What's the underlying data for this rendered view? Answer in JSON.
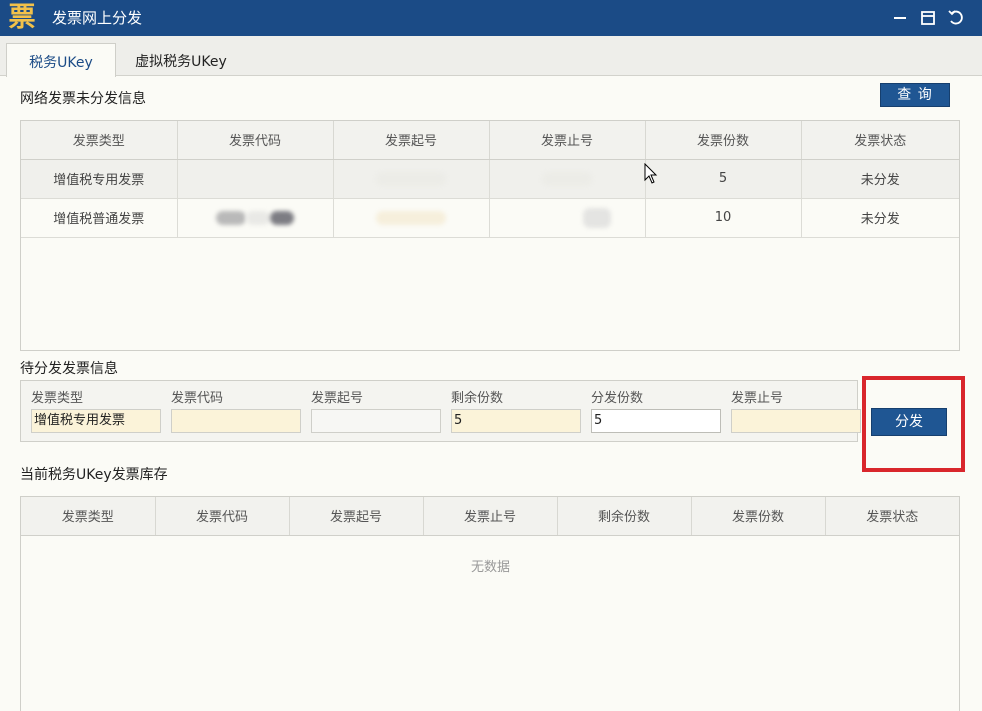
{
  "window": {
    "icon_glyph": "票",
    "title": "发票网上分发",
    "controls": [
      "minimize-icon",
      "maximize-icon",
      "back-icon"
    ]
  },
  "tabs": [
    {
      "label": "税务UKey",
      "active": true
    },
    {
      "label": "虚拟税务UKey",
      "active": false
    }
  ],
  "network_section": {
    "title": "网络发票未分发信息",
    "query_button": "查 询",
    "columns": [
      "发票类型",
      "发票代码",
      "发票起号",
      "发票止号",
      "发票份数",
      "发票状态"
    ],
    "rows": [
      {
        "type": "增值税专用发票",
        "code": "",
        "start": "",
        "end": "",
        "count": "5",
        "status": "未分发"
      },
      {
        "type": "增值税普通发票",
        "code": "",
        "start": "",
        "end": "",
        "count": "10",
        "status": "未分发"
      }
    ]
  },
  "pending_section": {
    "title": "待分发发票信息",
    "labels": {
      "type": "发票类型",
      "code": "发票代码",
      "start": "发票起号",
      "remaining": "剩余份数",
      "distribute_count": "分发份数",
      "end": "发票止号"
    },
    "values": {
      "type": "增值税专用发票",
      "code": "",
      "start": "",
      "remaining": "5",
      "distribute_count": "5",
      "end": ""
    },
    "distribute_button": "分发"
  },
  "inventory_section": {
    "title": "当前税务UKey发票库存",
    "columns": [
      "发票类型",
      "发票代码",
      "发票起号",
      "发票止号",
      "剩余份数",
      "发票份数",
      "发票状态"
    ],
    "empty_text": "无数据"
  },
  "colors": {
    "titlebar": "#1b4b86",
    "accent_button": "#1f5693",
    "highlight": "#d9262c",
    "readonly_field": "#fbf3d9"
  }
}
